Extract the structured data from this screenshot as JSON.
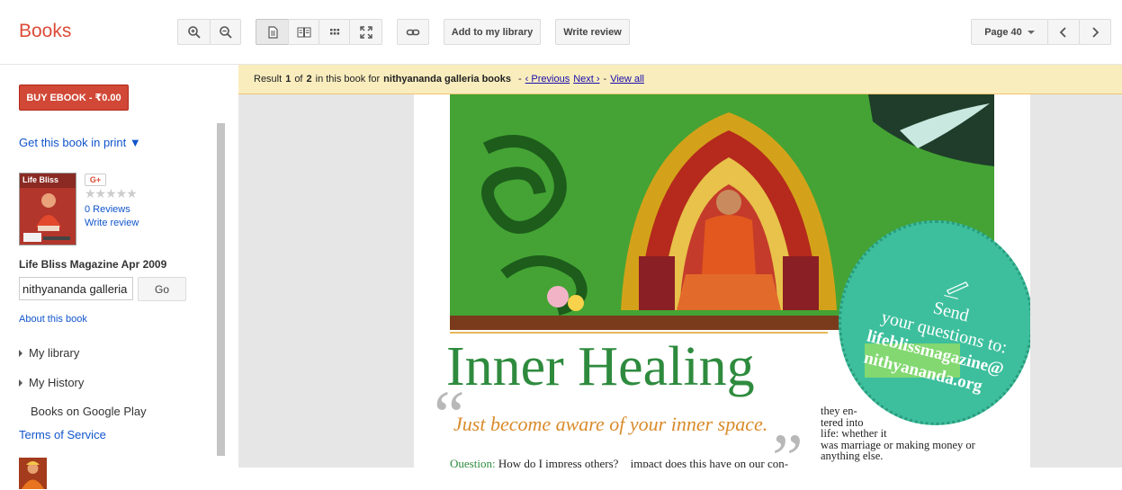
{
  "app": {
    "title": "Books"
  },
  "toolbar": {
    "add_library": "Add to my library",
    "write_review": "Write review",
    "page_label": "Page 40"
  },
  "sidebar": {
    "buy_label": "BUY EBOOK - ₹0.00",
    "get_print": "Get this book in print ▼",
    "cover_text": "Life Bliss",
    "gplus": "G+",
    "stars": "★★★★★",
    "reviews": "0 Reviews",
    "write_review": "Write review",
    "book_title": "Life Bliss Magazine Apr 2009",
    "search_value": "nithyananda galleria",
    "go_label": "Go",
    "about": "About this book",
    "items": [
      {
        "label": "My library"
      },
      {
        "label": "My History"
      },
      {
        "label": "Books on Google Play"
      }
    ],
    "terms": "Terms of Service"
  },
  "result": {
    "prefix": "Result",
    "current": "1",
    "of": "of",
    "total": "2",
    "middle": "in this book for",
    "query": "nithyananda galleria books",
    "sep": "-",
    "previous": "‹ Previous",
    "next": "Next ›",
    "view_all": "View all"
  },
  "page": {
    "headline": "Inner Healing",
    "tagline": "Just become aware of your inner space.",
    "question_label": "Question:",
    "question_text": "How do I impress others?",
    "col1_tail": "impact does this have on our con-",
    "col2": [
      "they en-",
      "tered  into",
      "life: whether it",
      "was marriage or making money or",
      "anything else."
    ],
    "circle": {
      "line1": "Send",
      "line2": "your questions to:",
      "line3": "lifeblissmagazine@",
      "line4": "nithyananda.org"
    }
  },
  "colors": {
    "brand": "#dd4b39",
    "buy": "#d14836",
    "link": "#1155cc",
    "result_bar": "#f9edbe",
    "headline": "#2e8b3e",
    "circle": "#3dbf9d"
  }
}
